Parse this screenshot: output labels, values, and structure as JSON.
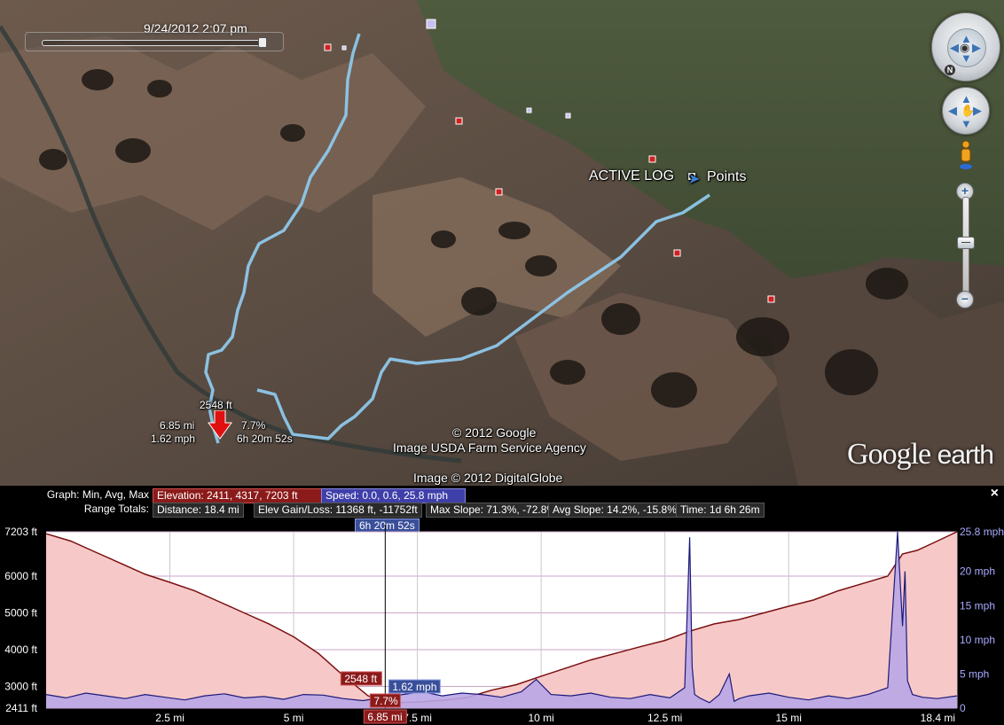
{
  "map": {
    "timestamp": "9/24/2012   2:07 pm",
    "active_log_label": "ACTIVE LOG",
    "points_label": "Points",
    "cursor_elevation": "2548 ft",
    "cursor_distance": "6.85 mi",
    "cursor_speed": "1.62 mph",
    "cursor_slope": "7.7%",
    "cursor_time": "6h 20m 52s",
    "credits": [
      "© 2012 Google",
      "Image USDA Farm Service Agency",
      "Image © 2012 DigitalGlobe"
    ],
    "logo_google": "Google",
    "logo_earth": "earth",
    "compass_north": "N",
    "zoom_in": "+",
    "zoom_out": "−"
  },
  "panel": {
    "graph_label": "Graph: Min, Avg, Max",
    "elevation_stat": "Elevation: 2411, 4317, 7203 ft",
    "speed_stat": "Speed: 0.0, 0.6, 25.8 mph",
    "range_label": "Range Totals:",
    "distance_stat": "Distance: 18.4 mi",
    "elev_gain_stat": "Elev Gain/Loss: 11368 ft, -11752ft",
    "max_slope_stat": "Max Slope: 71.3%, -72.8%",
    "avg_slope_stat": "Avg Slope: 14.2%, -15.8%",
    "time_stat": "Time: 1d 6h 26m",
    "close": "×",
    "cursor_time": "6h 20m 52s",
    "cursor_elev": "2548 ft",
    "cursor_speed": "1.62 mph",
    "cursor_slope": "7.7%",
    "cursor_dist": "6.85 mi"
  },
  "chart_data": {
    "type": "area",
    "x_label_ticks": [
      "2.5 mi",
      "5 mi",
      "7.5 mi",
      "10 mi",
      "12.5 mi",
      "15 mi",
      "18.4 mi"
    ],
    "x_ticks": [
      2.5,
      5,
      7.5,
      10,
      12.5,
      15,
      18.4
    ],
    "xlim": [
      0,
      18.4
    ],
    "y_left_ticks": [
      "7203 ft",
      "6000 ft",
      "5000 ft",
      "4000 ft",
      "3000 ft",
      "2411 ft"
    ],
    "y_left_values": [
      7203,
      6000,
      5000,
      4000,
      3000,
      2411
    ],
    "y_left_lim": [
      2411,
      7203
    ],
    "y_right_ticks": [
      "25.8 mph",
      "20 mph",
      "15 mph",
      "10 mph",
      "5 mph",
      "0"
    ],
    "y_right_values": [
      25.8,
      20,
      15,
      10,
      5,
      0
    ],
    "y_right_lim": [
      0,
      25.8
    ],
    "cursor_x": 6.85,
    "series": [
      {
        "name": "Elevation",
        "color": "#7a1010",
        "fill": "#f7c8c8",
        "x": [
          0,
          0.5,
          1.0,
          1.5,
          2.0,
          2.5,
          3.0,
          3.5,
          4.0,
          4.5,
          5.0,
          5.5,
          6.0,
          6.5,
          6.85,
          7.5,
          8.0,
          8.5,
          9.0,
          9.5,
          10.0,
          10.5,
          11.0,
          11.5,
          12.0,
          12.5,
          13.0,
          13.5,
          14.0,
          14.5,
          15.0,
          15.5,
          16.0,
          16.5,
          17.0,
          17.3,
          17.6,
          18.0,
          18.4
        ],
        "y": [
          7150,
          6950,
          6650,
          6350,
          6050,
          5830,
          5600,
          5300,
          5000,
          4700,
          4350,
          3900,
          3300,
          2750,
          2548,
          2580,
          2620,
          2700,
          2900,
          3050,
          3280,
          3500,
          3720,
          3900,
          4080,
          4250,
          4500,
          4700,
          4820,
          5000,
          5180,
          5350,
          5600,
          5800,
          6000,
          6600,
          6700,
          6950,
          7203
        ]
      },
      {
        "name": "Speed",
        "color": "#1a1a7a",
        "fill": "#b9a6e6",
        "x": [
          0,
          0.4,
          0.8,
          1.2,
          1.6,
          2.0,
          2.4,
          2.8,
          3.2,
          3.6,
          4.0,
          4.4,
          4.8,
          5.2,
          5.6,
          6.0,
          6.4,
          6.85,
          7.2,
          7.6,
          8.0,
          8.4,
          8.8,
          9.2,
          9.6,
          9.9,
          10.2,
          10.6,
          11.0,
          11.4,
          11.8,
          12.2,
          12.6,
          12.9,
          13.0,
          13.05,
          13.1,
          13.2,
          13.4,
          13.6,
          13.8,
          13.9,
          14.0,
          14.2,
          14.6,
          15.0,
          15.4,
          15.8,
          16.2,
          16.6,
          17.0,
          17.2,
          17.3,
          17.35,
          17.4,
          17.5,
          17.7,
          18.0,
          18.4
        ],
        "y": [
          2.0,
          1.5,
          2.2,
          1.8,
          1.4,
          2.0,
          1.6,
          1.2,
          1.8,
          2.1,
          1.5,
          1.7,
          1.3,
          2.0,
          1.9,
          1.4,
          1.1,
          1.62,
          2.0,
          2.4,
          1.8,
          2.2,
          2.0,
          1.6,
          2.4,
          4.2,
          2.0,
          1.8,
          2.2,
          1.6,
          1.4,
          2.0,
          1.5,
          3.0,
          25.0,
          6.0,
          2.0,
          1.5,
          0.8,
          2.0,
          5.0,
          1.0,
          1.4,
          1.8,
          2.2,
          1.6,
          1.2,
          1.8,
          1.4,
          2.0,
          3.0,
          25.8,
          12.0,
          20.0,
          4.0,
          2.0,
          1.6,
          1.4,
          1.8
        ]
      }
    ]
  }
}
